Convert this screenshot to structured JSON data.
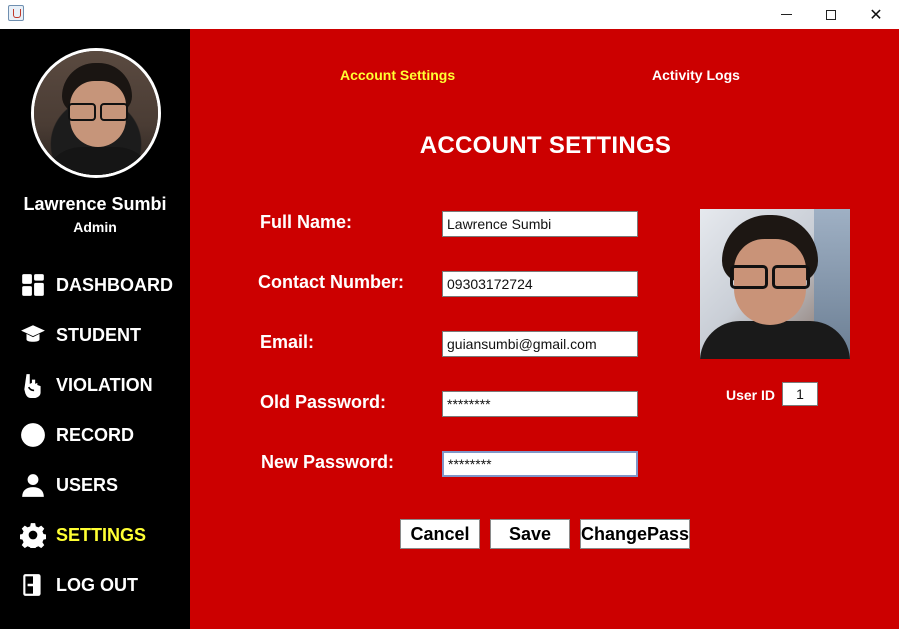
{
  "window": {
    "minimize_glyph": "",
    "maximize_glyph": "",
    "close_glyph": "✕"
  },
  "sidebar": {
    "user_name": "Lawrence Sumbi",
    "user_role": "Admin",
    "items": [
      {
        "label": "DASHBOARD",
        "icon": "dashboard-icon"
      },
      {
        "label": "STUDENT",
        "icon": "graduation-cap-icon"
      },
      {
        "label": "VIOLATION",
        "icon": "hand-pointer-icon"
      },
      {
        "label": "RECORD",
        "icon": "circle-icon"
      },
      {
        "label": "USERS",
        "icon": "user-icon"
      },
      {
        "label": "SETTINGS",
        "icon": "gear-icon",
        "active": true
      },
      {
        "label": "LOG OUT",
        "icon": "logout-icon"
      }
    ]
  },
  "tabs": {
    "account_settings": "Account Settings",
    "activity_logs": "Activity Logs"
  },
  "page_title": "ACCOUNT SETTINGS",
  "form": {
    "full_name_label": "Full Name:",
    "full_name_value": "Lawrence Sumbi",
    "contact_label": "Contact Number:",
    "contact_value": "09303172724",
    "email_label": "Email:",
    "email_value": "guiansumbi@gmail.com",
    "old_password_label": "Old Password:",
    "old_password_value": "********",
    "new_password_label": "New Password:",
    "new_password_value": "********"
  },
  "user_id": {
    "label": "User ID",
    "value": "1"
  },
  "buttons": {
    "cancel": "Cancel",
    "save": "Save",
    "change_pass": "ChangePass"
  },
  "colors": {
    "main_bg": "#cc0000",
    "sidebar_bg": "#000000",
    "active_text": "#ffff33"
  }
}
